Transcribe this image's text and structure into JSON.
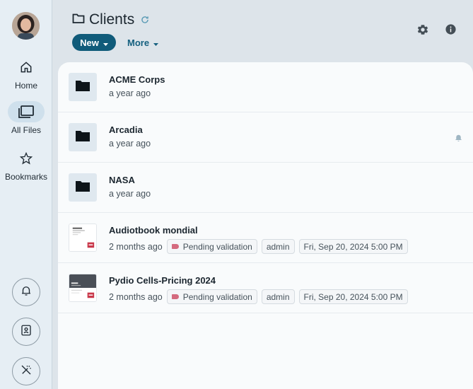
{
  "nav": {
    "home": "Home",
    "all_files": "All Files",
    "bookmarks": "Bookmarks"
  },
  "header": {
    "title": "Clients",
    "new_label": "New",
    "more_label": "More"
  },
  "files": [
    {
      "name": "ACME Corps",
      "modified": "a year ago",
      "type": "folder"
    },
    {
      "name": "Arcadia",
      "modified": "a year ago",
      "type": "folder",
      "watched": true
    },
    {
      "name": "NASA",
      "modified": "a year ago",
      "type": "folder"
    },
    {
      "name": "Audiotbook mondial",
      "modified": "2 months ago",
      "type": "pdf",
      "tag": "Pending validation",
      "user": "admin",
      "date": "Fri, Sep 20, 2024 5:00 PM"
    },
    {
      "name": "Pydio Cells-Pricing 2024",
      "modified": "2 months ago",
      "type": "pdf",
      "tag": "Pending validation",
      "user": "admin",
      "date": "Fri, Sep 20, 2024 5:00 PM"
    }
  ],
  "colors": {
    "accent": "#105b7a",
    "tag": "#d46a7e"
  }
}
